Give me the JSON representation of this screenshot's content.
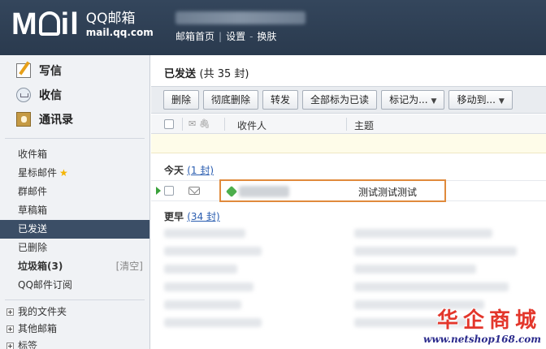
{
  "header": {
    "logo_main": "M",
    "logo_tail": "il",
    "brand": "QQ邮箱",
    "domain": "mail.qq.com",
    "nav": [
      "邮箱首页",
      "设置",
      "换肤"
    ]
  },
  "sidebar": {
    "compose": "写信",
    "inbox": "收信",
    "contacts": "通讯录",
    "folders": [
      {
        "label": "收件箱"
      },
      {
        "label": "星标邮件"
      },
      {
        "label": "群邮件"
      },
      {
        "label": "草稿箱"
      },
      {
        "label": "已发送",
        "active": true
      },
      {
        "label": "已删除"
      },
      {
        "label": "垃圾箱(3)",
        "action": "[清空]"
      },
      {
        "label": "QQ邮件订阅"
      }
    ],
    "groups": [
      "我的文件夹",
      "其他邮箱",
      "标签"
    ]
  },
  "main": {
    "title": "已发送",
    "count": "(共 35 封)",
    "toolbar": {
      "delete": "删除",
      "delete_permanent": "彻底删除",
      "forward": "转发",
      "mark_all_read": "全部标为已读",
      "mark_as": "标记为...",
      "move_to": "移动到..."
    },
    "columns": {
      "recipient": "收件人",
      "subject": "主题"
    },
    "groups": {
      "today": "今天",
      "today_count": "(1 封)",
      "earlier": "更早",
      "earlier_count": "(34 封)"
    },
    "rows": [
      {
        "subject": "测试测试测试"
      }
    ]
  },
  "watermark": {
    "title": "华企商城",
    "url": "www.netshop168.com"
  },
  "colors": {
    "header_bg": "#2f4055",
    "active_folder": "#3b4e66",
    "highlight_border": "#e08a3c",
    "star": "#f4b400"
  }
}
